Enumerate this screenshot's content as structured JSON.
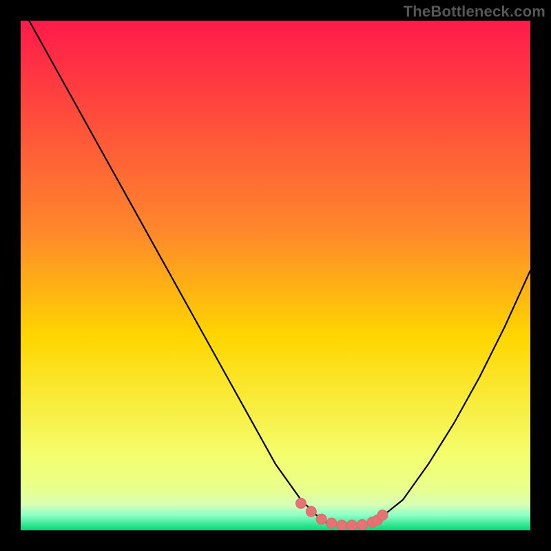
{
  "attribution": "TheBottleneck.com",
  "colors": {
    "frame": "#000000",
    "gradient_top": "#ff1a4a",
    "gradient_mid": "#ffd600",
    "gradient_low1": "#f3ff70",
    "gradient_low2": "#d6ffb6",
    "gradient_bottom": "#00d973",
    "curve": "#000000",
    "marker": "#e57373",
    "marker_stroke": "#d86a6a"
  },
  "chart_data": {
    "type": "line",
    "title": "",
    "xlabel": "",
    "ylabel": "",
    "ylim": [
      0,
      100
    ],
    "xlim": [
      0,
      100
    ],
    "series": [
      {
        "name": "bottleneck-curve",
        "x": [
          0,
          5,
          10,
          15,
          20,
          25,
          30,
          35,
          40,
          45,
          50,
          55,
          58,
          60,
          62,
          64,
          66,
          68,
          70,
          75,
          80,
          85,
          90,
          95,
          100
        ],
        "y": [
          103,
          94,
          85,
          76,
          67,
          58,
          49,
          40,
          31,
          22,
          13,
          6,
          3,
          1.5,
          1,
          1,
          1,
          1.2,
          2,
          6,
          13,
          21,
          30,
          40,
          51
        ]
      }
    ],
    "markers": {
      "name": "highlight-band",
      "x": [
        55,
        57,
        59,
        61,
        63,
        65,
        67,
        69,
        70,
        71
      ],
      "y": [
        5.3,
        3.7,
        2.2,
        1.4,
        1.0,
        1.0,
        1.1,
        1.6,
        2.0,
        3.0
      ]
    }
  }
}
